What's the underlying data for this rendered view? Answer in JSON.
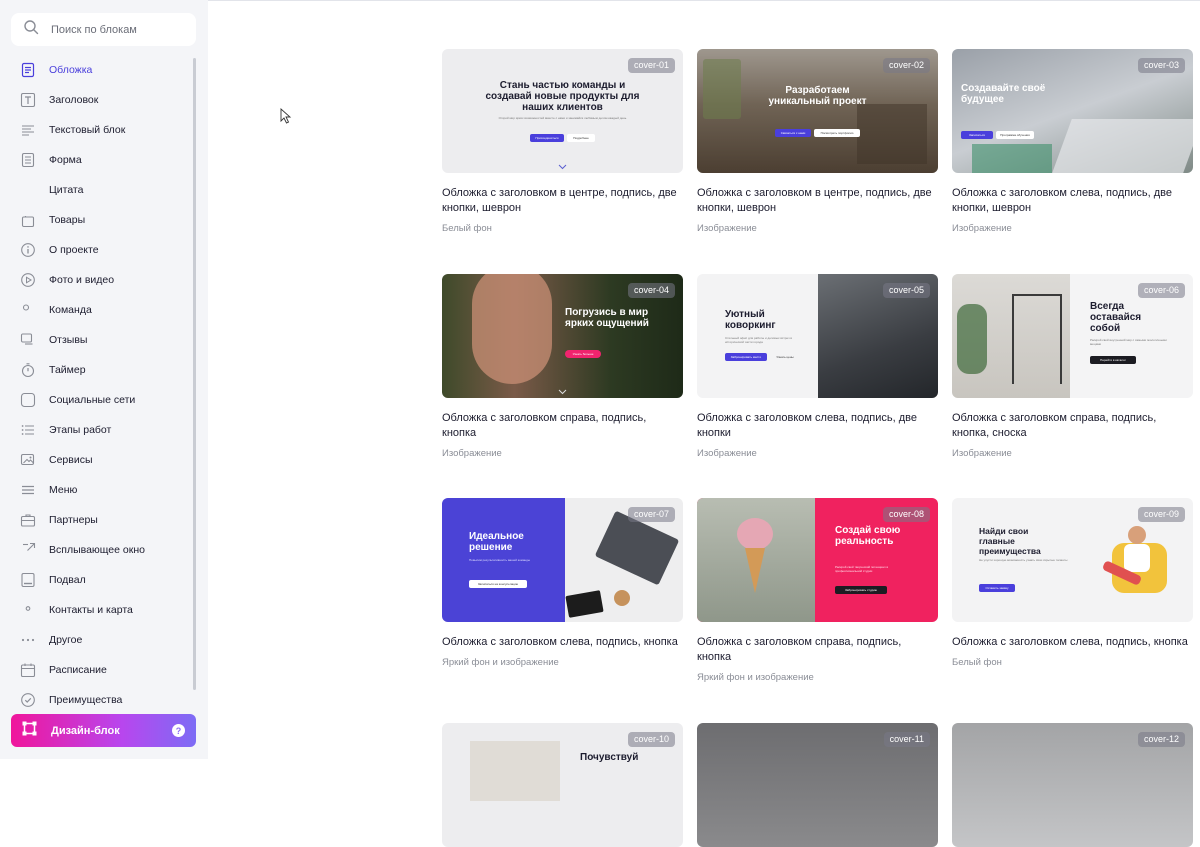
{
  "search": {
    "placeholder": "Поиск по блокам",
    "icon": "search-icon"
  },
  "sidebar": {
    "items": [
      {
        "label": "Обложка",
        "icon": "cover-icon",
        "active": true
      },
      {
        "label": "Заголовок",
        "icon": "heading-icon"
      },
      {
        "label": "Текстовый блок",
        "icon": "text-block-icon"
      },
      {
        "label": "Форма",
        "icon": "form-icon"
      },
      {
        "label": "Цитата",
        "icon": "quote-icon"
      },
      {
        "label": "Товары",
        "icon": "bag-icon"
      },
      {
        "label": "О проекте",
        "icon": "info-icon"
      },
      {
        "label": "Фото и видео",
        "icon": "play-icon"
      },
      {
        "label": "Команда",
        "icon": "team-icon"
      },
      {
        "label": "Отзывы",
        "icon": "reviews-icon"
      },
      {
        "label": "Таймер",
        "icon": "timer-icon"
      },
      {
        "label": "Социальные сети",
        "icon": "vk-icon"
      },
      {
        "label": "Этапы работ",
        "icon": "list-icon"
      },
      {
        "label": "Сервисы",
        "icon": "services-icon"
      },
      {
        "label": "Меню",
        "icon": "menu-icon"
      },
      {
        "label": "Партнеры",
        "icon": "briefcase-icon"
      },
      {
        "label": "Всплывающее окно",
        "icon": "popup-icon"
      },
      {
        "label": "Подвал",
        "icon": "footer-icon"
      },
      {
        "label": "Контакты и карта",
        "icon": "map-pin-icon"
      },
      {
        "label": "Другое",
        "icon": "dots-icon"
      },
      {
        "label": "Расписание",
        "icon": "calendar-icon"
      },
      {
        "label": "Преимущества",
        "icon": "check-icon"
      }
    ]
  },
  "design_block": {
    "label": "Дизайн-блок",
    "help": "?"
  },
  "cards": [
    {
      "badge": "cover-01",
      "title": "Обложка с заголовком в центре, подпись, две кнопки, шеврон",
      "subtitle": "Белый фон",
      "heading": "Стань частью команды и создавай новые продукты для наших клиентов",
      "caption": "Открой мир ярких возможностей вместе с нами и занимайся любимым делом каждый день",
      "btn1": "Присоединиться",
      "btn2": "Подробнее"
    },
    {
      "badge": "cover-02",
      "title": "Обложка с заголовком в центре, подпись, две кнопки, шеврон",
      "subtitle": "Изображение",
      "heading": "Разработаем уникальный проект",
      "btn1": "Связаться с нами",
      "btn2": "Посмотреть портфолио"
    },
    {
      "badge": "cover-03",
      "title": "Обложка с заголовком слева, подпись, две кнопки, шеврон",
      "subtitle": "Изображение",
      "heading": "Создавайте своё будущее",
      "btn1": "Записаться",
      "btn2": "Программа обучения"
    },
    {
      "badge": "cover-04",
      "title": "Обложка с заголовком справа, подпись, кнопка",
      "subtitle": "Изображение",
      "heading": "Погрузись в мир ярких ощущений",
      "btn1": "Узнать больше"
    },
    {
      "badge": "cover-05",
      "title": "Обложка с заголовком слева, подпись, две кнопки",
      "subtitle": "Изображение",
      "heading": "Уютный коворкинг",
      "caption": "Стильный офис для работы и деловых встреч в исторической части города",
      "btn1": "Забронировать место",
      "btn2": "Узнать цены"
    },
    {
      "badge": "cover-06",
      "title": "Обложка с заголовком справа, подпись, кнопка, сноска",
      "subtitle": "Изображение",
      "heading": "Всегда оставайся собой",
      "caption": "Раскрой свой внутренний мир с самыми экологичными вещами",
      "btn1": "Перейти в каталог"
    },
    {
      "badge": "cover-07",
      "title": "Обложка с заголовком слева, подпись, кнопка",
      "subtitle": "Яркий фон и изображение",
      "heading": "Идеальное решение",
      "caption": "Повысим результативность вашей команды",
      "btn1": "Записаться на консультацию"
    },
    {
      "badge": "cover-08",
      "title": "Обложка с заголовком справа, подпись, кнопка",
      "subtitle": "Яркий фон и изображение",
      "heading": "Создай свою реальность",
      "caption": "Раскрой свой творческий потенциал в профессиональной студии",
      "btn1": "Забронировать студию"
    },
    {
      "badge": "cover-09",
      "title": "Обложка с заголовком слева, подпись, кнопка",
      "subtitle": "Белый фон",
      "heading": "Найди свои главные преимущества",
      "caption": "Не упусти хорошую возможность узнать свои скрытые таланты",
      "btn1": "Оставить заявку"
    },
    {
      "badge": "cover-10",
      "heading": "Почувствуй"
    },
    {
      "badge": "cover-11"
    },
    {
      "badge": "cover-12"
    }
  ]
}
